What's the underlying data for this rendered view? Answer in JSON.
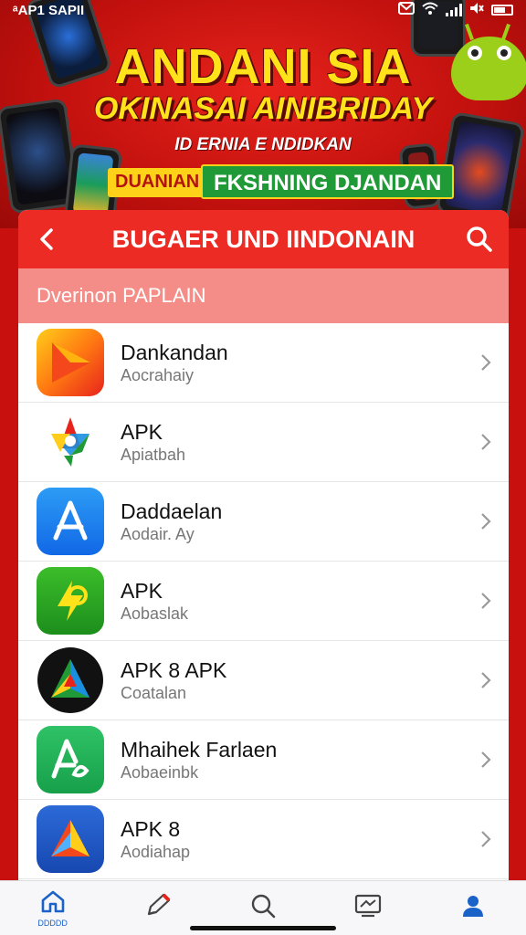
{
  "status_bar": {
    "left_text": "ᵃAP1 SAPII"
  },
  "banner": {
    "title_line1": "ANDANI SIA",
    "title_line2": "OKINASAI AINIBRIDAY",
    "subtitle": "ID ERNIA E NDIDKAN",
    "tag_yellow": "DUANIAN",
    "tag_green": "FKSHNING DJANDAN"
  },
  "header": {
    "title": "BUGAER UND IINDONAIN"
  },
  "section": {
    "label": "Dverinon PAPLAIN"
  },
  "apps": [
    {
      "title": "Dankandan",
      "subtitle": "Aocrahaiy",
      "icon": "red-arrow-play-icon"
    },
    {
      "title": "APK",
      "subtitle": "Apiatbah",
      "icon": "colorful-star-icon"
    },
    {
      "title": "Daddaelan",
      "subtitle": "Aodair. Ay",
      "icon": "app-store-a-icon"
    },
    {
      "title": "APK",
      "subtitle": "Aobaslak",
      "icon": "green-lightning-icon"
    },
    {
      "title": "APK 8 APK",
      "subtitle": "Coatalan",
      "icon": "dark-circle-triangle-icon"
    },
    {
      "title": "Mhaihek Farlaen",
      "subtitle": "Aobaeinbk",
      "icon": "green-a-icon"
    },
    {
      "title": "APK 8",
      "subtitle": "Aodiahap",
      "icon": "blue-triangle-icon"
    }
  ],
  "nav": {
    "home_label": "DDDDD"
  },
  "colors": {
    "brand_red": "#ec2b24",
    "section_pink": "#f48d88",
    "nav_blue": "#1a62c8"
  }
}
